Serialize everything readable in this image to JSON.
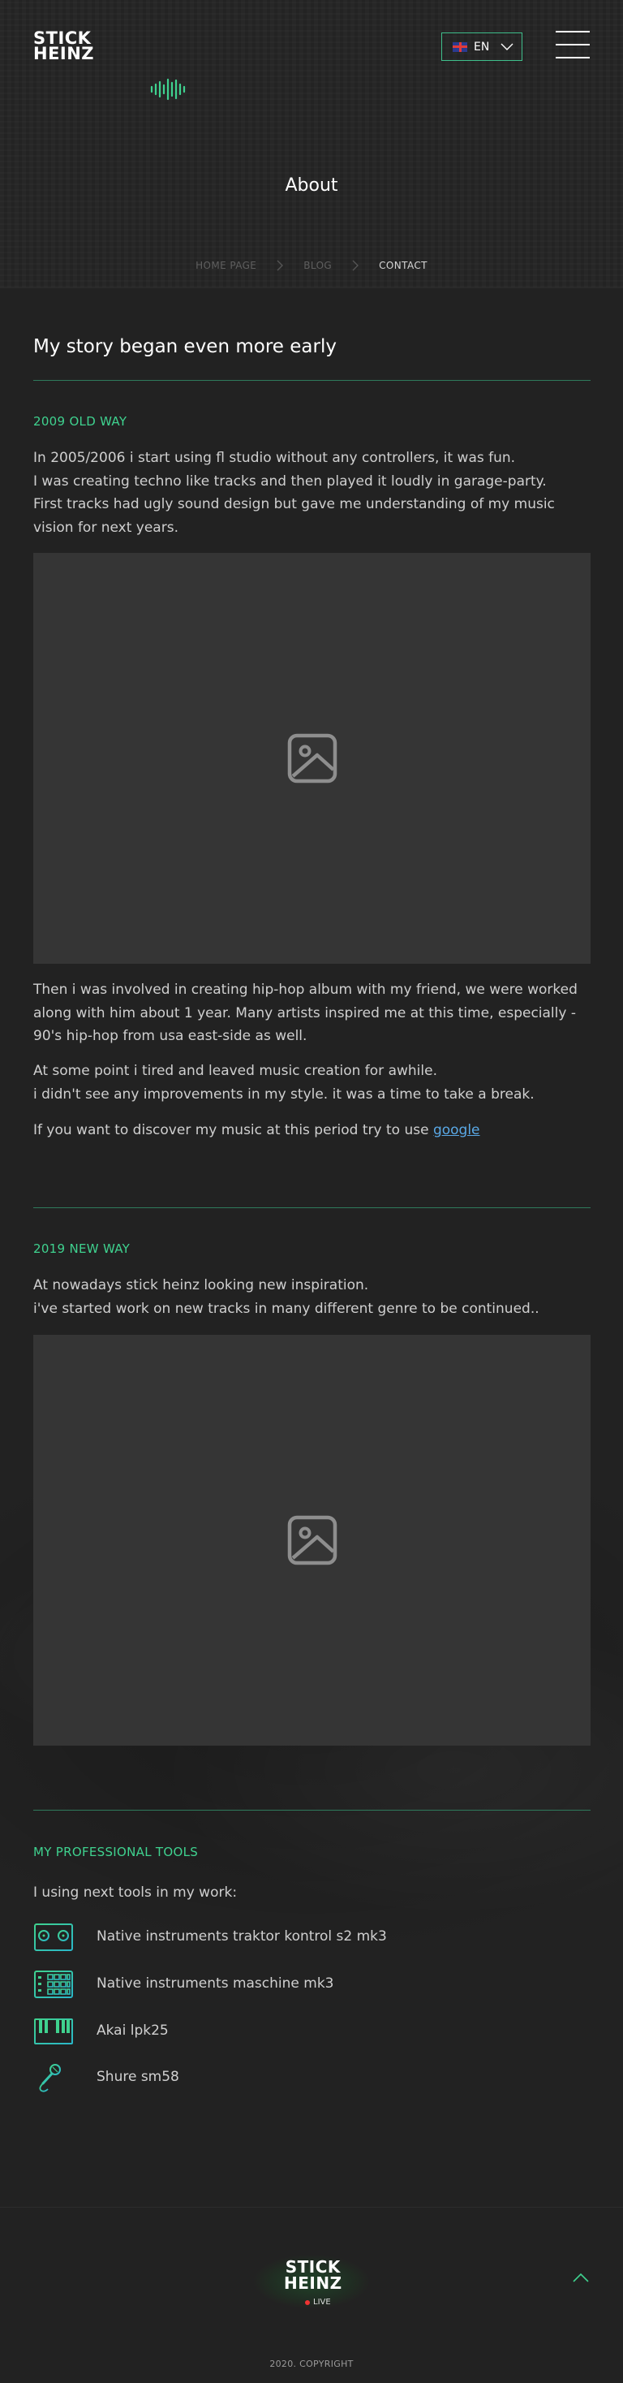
{
  "header": {
    "logo_line1": "STICK",
    "logo_line2": "HEINZ",
    "language": "EN",
    "page_title": "About",
    "breadcrumbs": [
      "HOME PAGE",
      "BLOG",
      "CONTACT"
    ]
  },
  "colors": {
    "accent": "#3fd28f",
    "background": "#222222",
    "link": "#5aa9e6"
  },
  "main": {
    "story_title": "My story began even more early",
    "sections": [
      {
        "title": "2009 OLD WAY",
        "intro": [
          "In 2005/2006 i start using fl studio without any controllers, it was fun.",
          "I was creating techno like tracks and then played it loudly in garage-party.",
          "First tracks had ugly sound design but gave me understanding of my music vision for next years."
        ],
        "after_image": [
          "Then i was involved in creating hip-hop album with my friend, we were worked along with him about 1 year. Many artists inspired me at this time, especially - 90's hip-hop from usa east-side as well.",
          "At some point i tired and leaved music creation for awhile.",
          "i didn't see any improvements in my style. it was a time to take a break."
        ],
        "link_sentence": "If you want to discover my music at this period try to use ",
        "link_text": "google"
      },
      {
        "title": "2019 NEW WAY",
        "intro": [
          "At nowadays stick heinz looking new inspiration.",
          "i've started work on new tracks in many different genre to be continued.."
        ]
      }
    ],
    "tools": {
      "title": "MY PROFESSIONAL TOOLS",
      "intro": "I using next tools in my work:",
      "items": [
        {
          "icon": "dj-controller-icon",
          "label": "Native instruments traktor kontrol s2 mk3"
        },
        {
          "icon": "drum-pad-icon",
          "label": "Native instruments maschine mk3"
        },
        {
          "icon": "midi-keyboard-icon",
          "label": "Akai lpk25"
        },
        {
          "icon": "microphone-icon",
          "label": "Shure sm58"
        }
      ]
    }
  },
  "footer": {
    "logo_line1": "STICK",
    "logo_line2": "HEINZ",
    "live_label": "LIVE",
    "copyright": "2020. COPYRIGHT"
  }
}
